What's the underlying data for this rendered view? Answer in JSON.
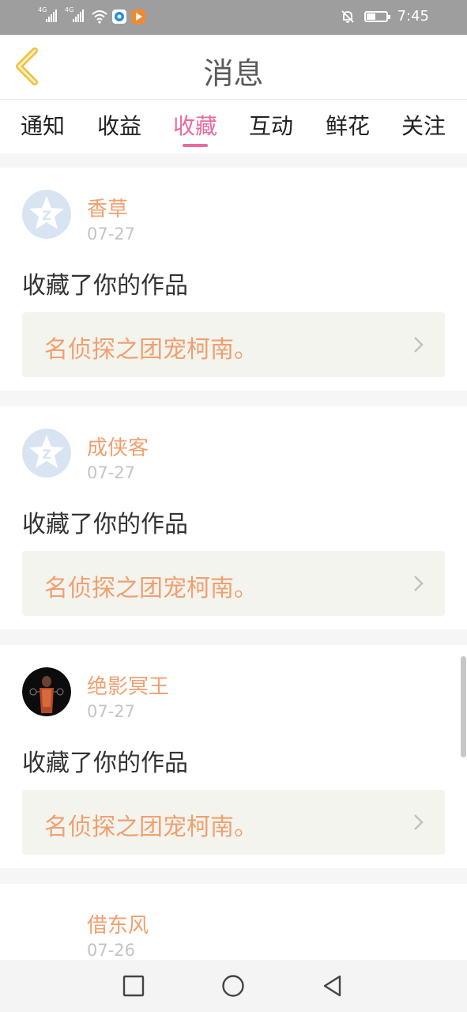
{
  "status_bar": {
    "signal1_label": "4G",
    "signal2_label": "4G",
    "time": "7:45",
    "battery_level": 0.45,
    "icons": [
      "signal-icon",
      "signal-icon",
      "wifi-icon",
      "browser-app-icon",
      "video-app-icon",
      "mute-bell-icon",
      "battery-icon"
    ]
  },
  "header": {
    "title": "消息",
    "back_icon": "chevron-left-icon"
  },
  "tabs": [
    {
      "label": "通知"
    },
    {
      "label": "收益"
    },
    {
      "label": "收藏",
      "active": true
    },
    {
      "label": "互动"
    },
    {
      "label": "鲜花"
    },
    {
      "label": "关注"
    }
  ],
  "messages": [
    {
      "user": "香草",
      "date": "07-27",
      "action": "收藏了你的作品",
      "work": "名侦探之团宠柯南。",
      "avatar": "default-avatar-icon"
    },
    {
      "user": "成侠客",
      "date": "07-27",
      "action": "收藏了你的作品",
      "work": "名侦探之团宠柯南。",
      "avatar": "default-avatar-icon"
    },
    {
      "user": "绝影冥王",
      "date": "07-27",
      "action": "收藏了你的作品",
      "work": "名侦探之团宠柯南。",
      "avatar": "user-photo-avatar"
    },
    {
      "user": "借东风",
      "date": "07-26",
      "action": "",
      "work": "",
      "avatar": "blank-avatar"
    }
  ],
  "nav_bar": {
    "icons": [
      "recent-apps-icon",
      "home-icon",
      "back-triangle-icon"
    ]
  },
  "colors": {
    "accent": "#e86aa0",
    "username": "#f0a070",
    "work_title": "#f0a070",
    "date": "#c4c4c4",
    "back_chevron": "#f0c040"
  }
}
